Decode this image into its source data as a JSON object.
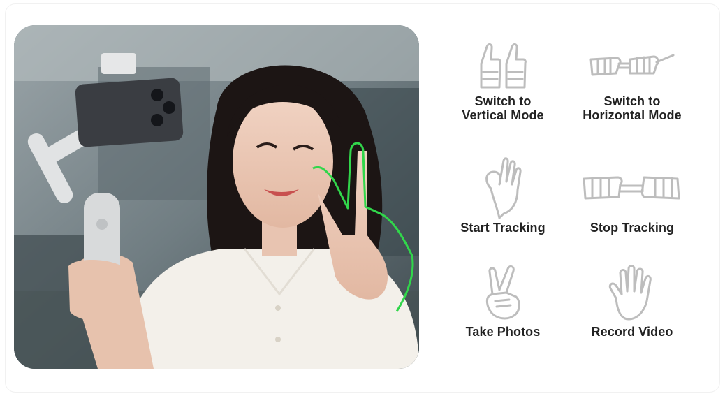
{
  "gestures": [
    {
      "id": "vertical",
      "label_line1": "Switch to",
      "label_line2": "Vertical Mode",
      "icon": "two-thumbs-up-icon"
    },
    {
      "id": "horizontal",
      "label_line1": "Switch to",
      "label_line2": "Horizontal Mode",
      "icon": "horizontal-fists-icon"
    },
    {
      "id": "start",
      "label": "Start Tracking",
      "icon": "ok-hand-icon"
    },
    {
      "id": "stop",
      "label": "Stop Tracking",
      "icon": "joined-fists-icon"
    },
    {
      "id": "photos",
      "label": "Take Photos",
      "icon": "victory-hand-icon"
    },
    {
      "id": "video",
      "label": "Record Video",
      "icon": "open-palm-icon"
    }
  ],
  "photo": {
    "description_icon": "woman-selfie-gimbal-photo",
    "outline_color": "#31d64b"
  },
  "colors": {
    "icon_stroke": "#bdbdbd",
    "label": "#222222"
  }
}
